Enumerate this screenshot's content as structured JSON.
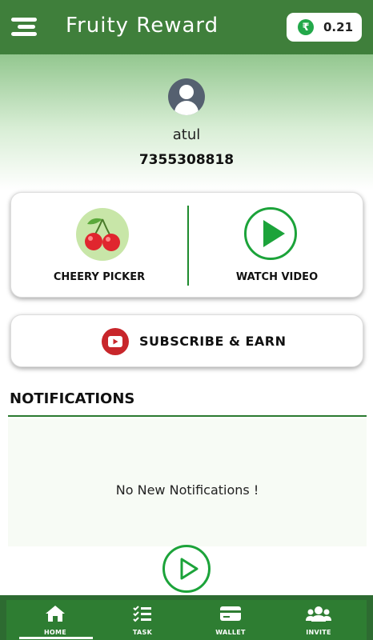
{
  "header": {
    "title": "Fruity Reward",
    "menu_icon": "hamburger-menu-icon",
    "balance": {
      "currency_icon": "rupee-icon",
      "currency_symbol": "₹",
      "value": "0.21"
    }
  },
  "profile": {
    "avatar_icon": "user-avatar-icon",
    "name": "atul",
    "phone": "7355308818"
  },
  "actions": [
    {
      "label": "CHEERY PICKER",
      "icon": "cherry-icon"
    },
    {
      "label": "WATCH VIDEO",
      "icon": "play-icon"
    }
  ],
  "subscribe": {
    "label": "SUBSCRIBE & EARN",
    "icon": "youtube-icon"
  },
  "notifications": {
    "title": "NOTIFICATIONS",
    "empty_text": "No New Notifications !"
  },
  "bottom_nav": {
    "active": "HOME",
    "items": [
      {
        "label": "HOME",
        "icon": "home-icon"
      },
      {
        "label": "TASK",
        "icon": "checklist-icon"
      },
      {
        "label": "WALLET",
        "icon": "wallet-icon"
      },
      {
        "label": "INVITE",
        "icon": "users-icon"
      }
    ]
  },
  "colors": {
    "primary_green": "#3f7f3b",
    "accent_green": "#1ca33a",
    "youtube_red": "#c8262b",
    "nav_green": "#2e7d32"
  }
}
